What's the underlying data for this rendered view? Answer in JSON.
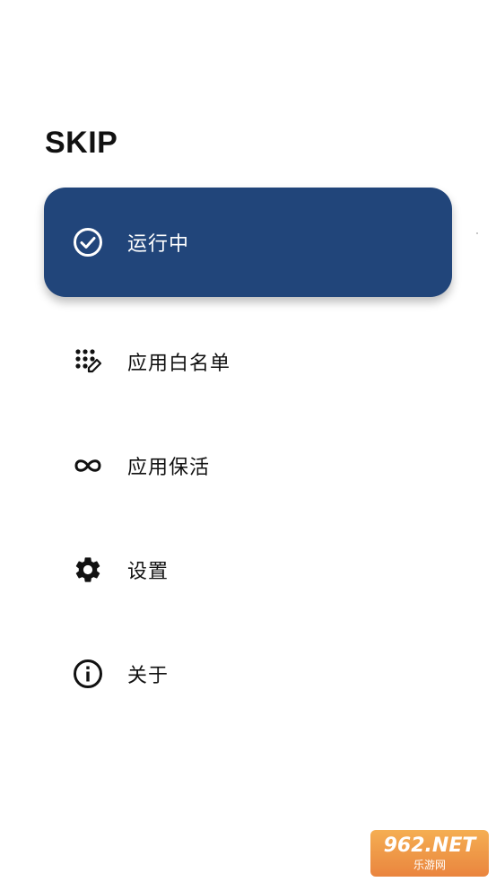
{
  "app": {
    "title": "SKIP"
  },
  "nav": {
    "items": [
      {
        "label": "运行中",
        "icon": "check-circle-icon",
        "active": true
      },
      {
        "label": "应用白名单",
        "icon": "dots-edit-icon",
        "active": false
      },
      {
        "label": "应用保活",
        "icon": "infinity-icon",
        "active": false
      },
      {
        "label": "设置",
        "icon": "gear-icon",
        "active": false
      },
      {
        "label": "关于",
        "icon": "info-icon",
        "active": false
      }
    ]
  },
  "watermark": {
    "top": "962.NET",
    "bottom": "乐游网"
  },
  "colors": {
    "active_bg": "#21457a",
    "active_text": "#ffffff",
    "text": "#111111"
  }
}
